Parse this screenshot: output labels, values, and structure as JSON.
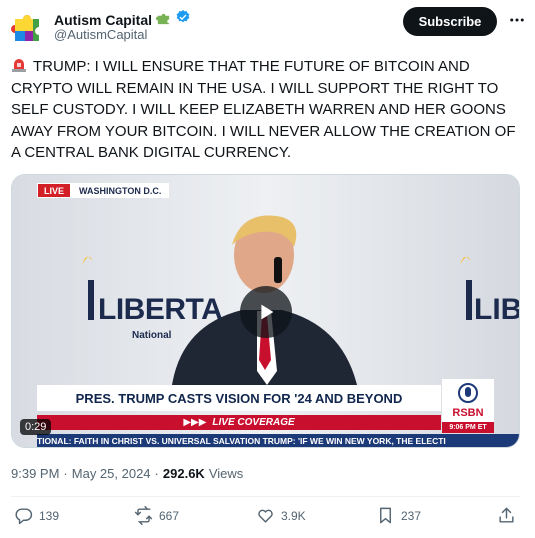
{
  "author": {
    "name": "Autism Capital",
    "handle": "@AutismCapital",
    "badge_emoji": "🧩"
  },
  "subscribe_label": "Subscribe",
  "tweet_text": "TRUMP: I WILL ENSURE THAT THE FUTURE OF BITCOIN AND CRYPTO WILL REMAIN IN THE USA. I WILL SUPPORT THE RIGHT TO SELF CUSTODY. I WILL KEEP ELIZABETH WARREN AND HER GOONS AWAY FROM YOUR BITCOIN. I WILL NEVER ALLOW THE CREATION OF A CENTRAL BANK DIGITAL CURRENCY.",
  "video": {
    "live_label": "LIVE",
    "location": "WASHINGTON D.C.",
    "headline": "PRES. TRUMP CASTS VISION FOR '24 AND BEYOND",
    "live_coverage": "LIVE COVERAGE",
    "network": "RSBN",
    "network_time": "9:06 PM ET",
    "ticker": "TIONAL: FAITH IN CHRIST VS. UNIVERSAL SALVATION    TRUMP: 'IF WE WIN NEW YORK, THE ELECTI",
    "backdrop_text_left": "LIBERTA",
    "backdrop_subtext": "National",
    "backdrop_text_right": "LIB",
    "duration": "0:29"
  },
  "meta": {
    "time": "9:39 PM",
    "separator": "·",
    "date": "May 25, 2024",
    "views_count": "292.6K",
    "views_label": "Views"
  },
  "actions": {
    "replies": "139",
    "reposts": "667",
    "likes": "3.9K",
    "bookmarks": "237"
  },
  "colors": {
    "verified_blue": "#1d9bf0",
    "text_primary": "#0f1419",
    "text_secondary": "#536471",
    "rsbn_red": "#c8102e",
    "ticker_blue": "#1d3a78"
  }
}
